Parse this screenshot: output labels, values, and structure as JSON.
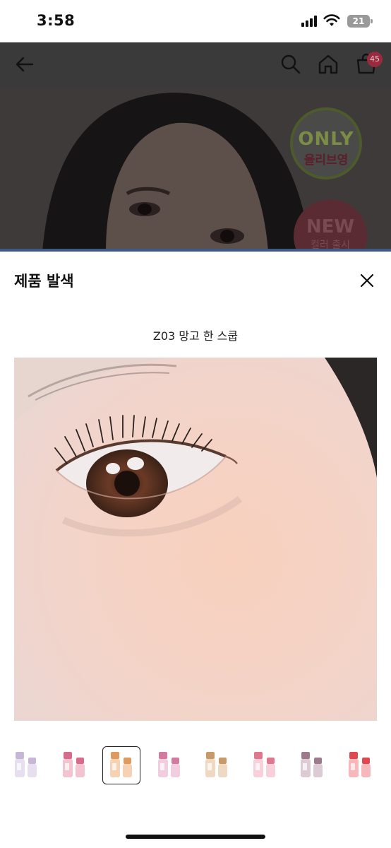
{
  "status_bar": {
    "time": "3:58",
    "battery": "21",
    "icons": [
      "signal-icon",
      "wifi-icon",
      "battery-icon"
    ]
  },
  "header": {
    "icons": [
      "back-arrow-icon",
      "search-icon",
      "home-icon",
      "cart-icon"
    ],
    "cart_count": "45"
  },
  "hero": {
    "badge_only": {
      "line1": "ONLY",
      "line2": "올리브영"
    },
    "badge_new": {
      "line1": "NEW",
      "line2": "컬러 출시"
    }
  },
  "sheet": {
    "title": "제품 발색",
    "close_icon": "close-icon",
    "shade_name": "Z03 망고 한 스쿱",
    "thumbnails": [
      {
        "name": "shade-1",
        "cap": "#c7b6d6",
        "body": "#e7dff0",
        "selected": false
      },
      {
        "name": "shade-2",
        "cap": "#d86a8c",
        "body": "#f3c3d0",
        "selected": false
      },
      {
        "name": "shade-3",
        "cap": "#e19a5e",
        "body": "#f6d2b5",
        "selected": true
      },
      {
        "name": "shade-4",
        "cap": "#d47aa0",
        "body": "#f1cde0",
        "selected": false
      },
      {
        "name": "shade-5",
        "cap": "#c79a6a",
        "body": "#efd9c2",
        "selected": false
      },
      {
        "name": "shade-6",
        "cap": "#e0768f",
        "body": "#f7d0da",
        "selected": false
      },
      {
        "name": "shade-7",
        "cap": "#9e7a8e",
        "body": "#dccbd5",
        "selected": false
      },
      {
        "name": "shade-8",
        "cap": "#e0474e",
        "body": "#f6b8bb",
        "selected": false
      }
    ]
  },
  "colors": {
    "overlay": "#3a3a3a",
    "accent": "#9a2a3d"
  }
}
